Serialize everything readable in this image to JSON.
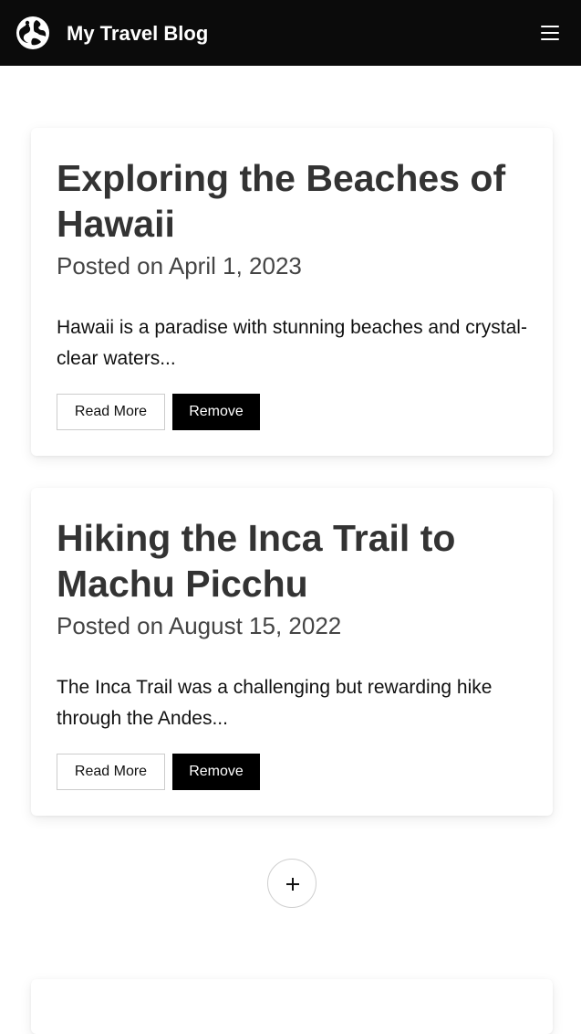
{
  "header": {
    "brand": "My Travel Blog",
    "logo_icon": "globe-traveler-icon",
    "menu_icon": "hamburger-menu-icon",
    "background": "#0b0b0b"
  },
  "posts": [
    {
      "title": "Exploring the Beaches of Hawaii",
      "date": "Posted on April 1, 2023",
      "excerpt": "Hawaii is a paradise with stunning beaches and crystal-clear waters...",
      "read_more_label": "Read More",
      "remove_label": "Remove"
    },
    {
      "title": "Hiking the Inca Trail to Machu Picchu",
      "date": "Posted on August 15, 2022",
      "excerpt": "The Inca Trail was a challenging but rewarding hike through the Andes...",
      "read_more_label": "Read More",
      "remove_label": "Remove"
    }
  ],
  "add_button": {
    "icon": "plus-icon"
  },
  "colors": {
    "accent": "#000000",
    "text": "#333333"
  }
}
